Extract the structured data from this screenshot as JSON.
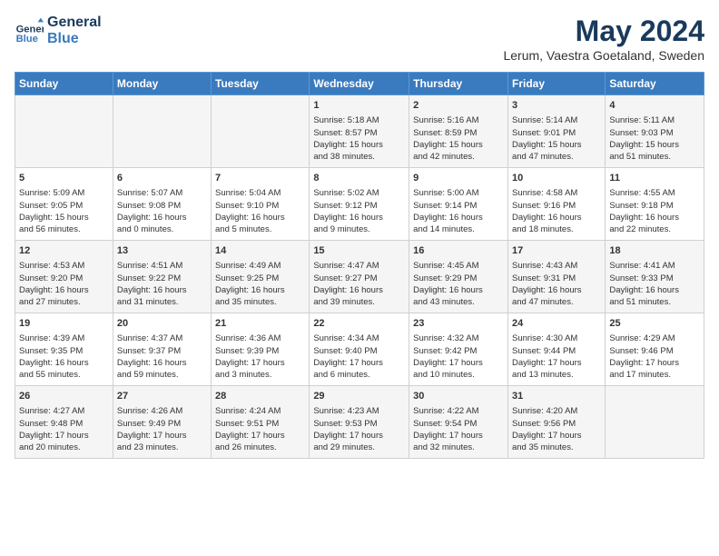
{
  "header": {
    "logo_line1": "General",
    "logo_line2": "Blue",
    "month": "May 2024",
    "location": "Lerum, Vaestra Goetaland, Sweden"
  },
  "weekdays": [
    "Sunday",
    "Monday",
    "Tuesday",
    "Wednesday",
    "Thursday",
    "Friday",
    "Saturday"
  ],
  "weeks": [
    [
      {
        "day": "",
        "info": ""
      },
      {
        "day": "",
        "info": ""
      },
      {
        "day": "",
        "info": ""
      },
      {
        "day": "1",
        "info": "Sunrise: 5:18 AM\nSunset: 8:57 PM\nDaylight: 15 hours\nand 38 minutes."
      },
      {
        "day": "2",
        "info": "Sunrise: 5:16 AM\nSunset: 8:59 PM\nDaylight: 15 hours\nand 42 minutes."
      },
      {
        "day": "3",
        "info": "Sunrise: 5:14 AM\nSunset: 9:01 PM\nDaylight: 15 hours\nand 47 minutes."
      },
      {
        "day": "4",
        "info": "Sunrise: 5:11 AM\nSunset: 9:03 PM\nDaylight: 15 hours\nand 51 minutes."
      }
    ],
    [
      {
        "day": "5",
        "info": "Sunrise: 5:09 AM\nSunset: 9:05 PM\nDaylight: 15 hours\nand 56 minutes."
      },
      {
        "day": "6",
        "info": "Sunrise: 5:07 AM\nSunset: 9:08 PM\nDaylight: 16 hours\nand 0 minutes."
      },
      {
        "day": "7",
        "info": "Sunrise: 5:04 AM\nSunset: 9:10 PM\nDaylight: 16 hours\nand 5 minutes."
      },
      {
        "day": "8",
        "info": "Sunrise: 5:02 AM\nSunset: 9:12 PM\nDaylight: 16 hours\nand 9 minutes."
      },
      {
        "day": "9",
        "info": "Sunrise: 5:00 AM\nSunset: 9:14 PM\nDaylight: 16 hours\nand 14 minutes."
      },
      {
        "day": "10",
        "info": "Sunrise: 4:58 AM\nSunset: 9:16 PM\nDaylight: 16 hours\nand 18 minutes."
      },
      {
        "day": "11",
        "info": "Sunrise: 4:55 AM\nSunset: 9:18 PM\nDaylight: 16 hours\nand 22 minutes."
      }
    ],
    [
      {
        "day": "12",
        "info": "Sunrise: 4:53 AM\nSunset: 9:20 PM\nDaylight: 16 hours\nand 27 minutes."
      },
      {
        "day": "13",
        "info": "Sunrise: 4:51 AM\nSunset: 9:22 PM\nDaylight: 16 hours\nand 31 minutes."
      },
      {
        "day": "14",
        "info": "Sunrise: 4:49 AM\nSunset: 9:25 PM\nDaylight: 16 hours\nand 35 minutes."
      },
      {
        "day": "15",
        "info": "Sunrise: 4:47 AM\nSunset: 9:27 PM\nDaylight: 16 hours\nand 39 minutes."
      },
      {
        "day": "16",
        "info": "Sunrise: 4:45 AM\nSunset: 9:29 PM\nDaylight: 16 hours\nand 43 minutes."
      },
      {
        "day": "17",
        "info": "Sunrise: 4:43 AM\nSunset: 9:31 PM\nDaylight: 16 hours\nand 47 minutes."
      },
      {
        "day": "18",
        "info": "Sunrise: 4:41 AM\nSunset: 9:33 PM\nDaylight: 16 hours\nand 51 minutes."
      }
    ],
    [
      {
        "day": "19",
        "info": "Sunrise: 4:39 AM\nSunset: 9:35 PM\nDaylight: 16 hours\nand 55 minutes."
      },
      {
        "day": "20",
        "info": "Sunrise: 4:37 AM\nSunset: 9:37 PM\nDaylight: 16 hours\nand 59 minutes."
      },
      {
        "day": "21",
        "info": "Sunrise: 4:36 AM\nSunset: 9:39 PM\nDaylight: 17 hours\nand 3 minutes."
      },
      {
        "day": "22",
        "info": "Sunrise: 4:34 AM\nSunset: 9:40 PM\nDaylight: 17 hours\nand 6 minutes."
      },
      {
        "day": "23",
        "info": "Sunrise: 4:32 AM\nSunset: 9:42 PM\nDaylight: 17 hours\nand 10 minutes."
      },
      {
        "day": "24",
        "info": "Sunrise: 4:30 AM\nSunset: 9:44 PM\nDaylight: 17 hours\nand 13 minutes."
      },
      {
        "day": "25",
        "info": "Sunrise: 4:29 AM\nSunset: 9:46 PM\nDaylight: 17 hours\nand 17 minutes."
      }
    ],
    [
      {
        "day": "26",
        "info": "Sunrise: 4:27 AM\nSunset: 9:48 PM\nDaylight: 17 hours\nand 20 minutes."
      },
      {
        "day": "27",
        "info": "Sunrise: 4:26 AM\nSunset: 9:49 PM\nDaylight: 17 hours\nand 23 minutes."
      },
      {
        "day": "28",
        "info": "Sunrise: 4:24 AM\nSunset: 9:51 PM\nDaylight: 17 hours\nand 26 minutes."
      },
      {
        "day": "29",
        "info": "Sunrise: 4:23 AM\nSunset: 9:53 PM\nDaylight: 17 hours\nand 29 minutes."
      },
      {
        "day": "30",
        "info": "Sunrise: 4:22 AM\nSunset: 9:54 PM\nDaylight: 17 hours\nand 32 minutes."
      },
      {
        "day": "31",
        "info": "Sunrise: 4:20 AM\nSunset: 9:56 PM\nDaylight: 17 hours\nand 35 minutes."
      },
      {
        "day": "",
        "info": ""
      }
    ]
  ]
}
